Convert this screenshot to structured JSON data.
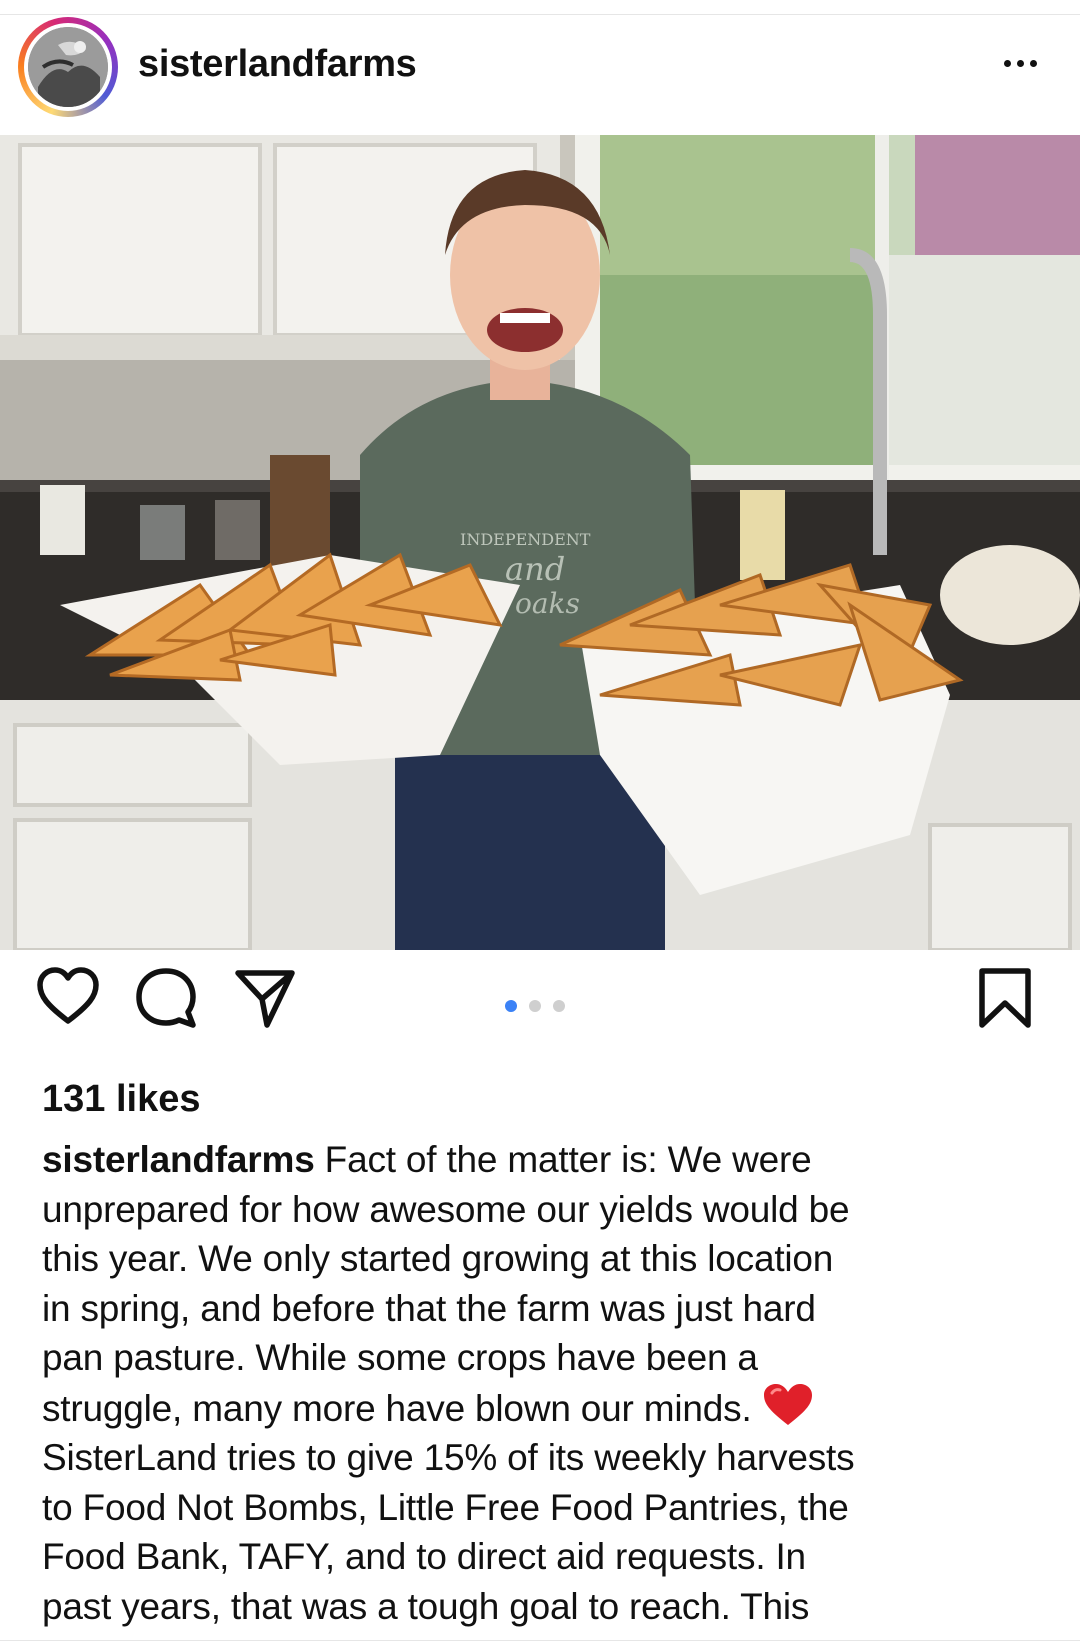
{
  "post": {
    "username": "sisterlandfarms",
    "likes": "131 likes",
    "caption_user": "sisterlandfarms",
    "caption_lines": [
      "Fact of the matter is: We were",
      "unprepared for how awesome our yields would be",
      "this year. We only started growing at this location",
      "in spring, and before that the farm was just hard",
      "pan pasture. While some crops have been a",
      "struggle, many more have blown our minds.",
      "SisterLand tries to give 15% of its weekly harvests",
      "to Food Not Bombs, Little Free Food Pantries, the",
      "Food Bank, TAFY, and to direct aid requests. In",
      "past years, that was a tough goal to reach. This"
    ],
    "caption_emoji": "red-heart-emoji"
  },
  "carousel": {
    "count": 3,
    "active_index": 0
  },
  "photo": {
    "description_icon": "photo-woman-with-trays-of-pastries",
    "shirt_text": "Independent and Oaks"
  },
  "icons": {
    "more": "more-options-icon",
    "like": "heart-icon",
    "comment": "comment-icon",
    "share": "share-icon",
    "save": "bookmark-icon"
  },
  "colors": {
    "accent": "#3b82f6",
    "heart": "#e0202a"
  }
}
